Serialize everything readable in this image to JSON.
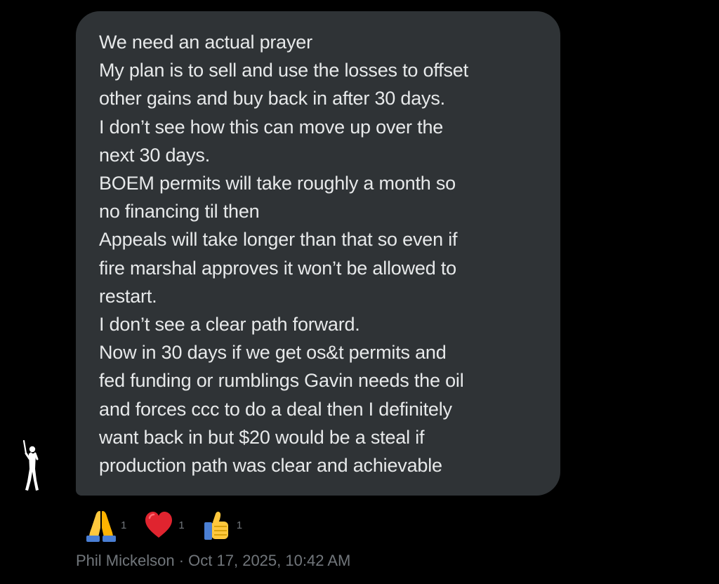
{
  "message": {
    "lines": [
      "We need an actual prayer",
      "My plan is to sell and use the losses to offset",
      "other gains and buy back in after 30 days.",
      "I don’t see how this can move up over the",
      "next 30 days.",
      "BOEM permits will take roughly a month so",
      "no financing til then",
      "Appeals will take longer than that so even if",
      "fire marshal approves it won’t be allowed to",
      "restart.",
      "I don’t see a clear path forward.",
      "Now in 30 days if we get os&t permits and",
      "fed funding or rumblings Gavin needs the oil",
      "and forces ccc to do a deal then I definitely",
      "want back in but $20 would be a steal if",
      "production path was clear and achievable"
    ]
  },
  "avatar": {
    "icon": "golfer-silhouette-icon"
  },
  "reactions": [
    {
      "icon": "folded-hands-emoji-icon",
      "count": "1"
    },
    {
      "icon": "red-heart-emoji-icon",
      "count": "1"
    },
    {
      "icon": "thumbs-up-emoji-icon",
      "count": "1"
    }
  ],
  "meta": {
    "sender": "Phil Mickelson",
    "separator": " · ",
    "timestamp": "Oct 17, 2025, 10:42 AM"
  },
  "colors": {
    "background": "#000000",
    "bubble": "#2f3336",
    "message_text": "#e7e9ea",
    "meta_text": "#71767b"
  }
}
